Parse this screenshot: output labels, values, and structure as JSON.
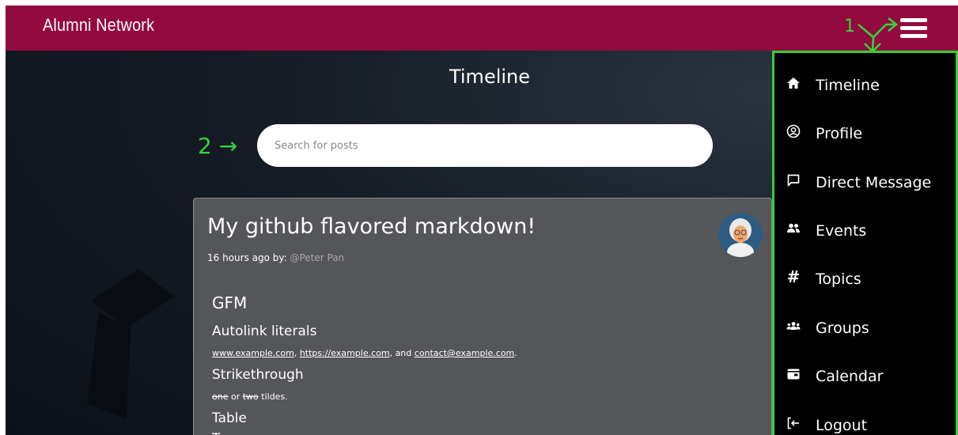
{
  "app": {
    "brand": "Alumni Network"
  },
  "annotations": {
    "one": "1",
    "two": "2 →",
    "color": "#37d43a"
  },
  "page": {
    "title": "Timeline"
  },
  "search": {
    "placeholder": "Search for posts",
    "value": ""
  },
  "post": {
    "title": "My github flavored markdown!",
    "meta_prefix": "16 hours ago by: ",
    "author": "@Peter Pan",
    "body": {
      "h_gfm": "GFM",
      "h_autolink": "Autolink literals",
      "link1": "www.example.com",
      "sep1": ", ",
      "link2": "https://example.com",
      "sep2": ", and ",
      "link3": "contact@example.com",
      "end1": ".",
      "h_strike": "Strikethrough",
      "strike1": "one",
      "mid": " or ",
      "strike2": "two",
      "tail": " tildes.",
      "h_table": "Table",
      "h_next": "Ta"
    }
  },
  "sidebar": {
    "items": [
      {
        "label": "Timeline",
        "icon": "home-icon"
      },
      {
        "label": "Profile",
        "icon": "user-circle-icon"
      },
      {
        "label": "Direct Message",
        "icon": "chat-bubble-icon"
      },
      {
        "label": "Events",
        "icon": "people-icon"
      },
      {
        "label": "Topics",
        "icon": "hash-icon"
      },
      {
        "label": "Groups",
        "icon": "group-icon"
      },
      {
        "label": "Calendar",
        "icon": "calendar-icon"
      },
      {
        "label": "Logout",
        "icon": "logout-icon"
      }
    ]
  },
  "colors": {
    "topbar": "#930a3f",
    "highlight": "#33d12f",
    "post_bg": "#555659"
  }
}
